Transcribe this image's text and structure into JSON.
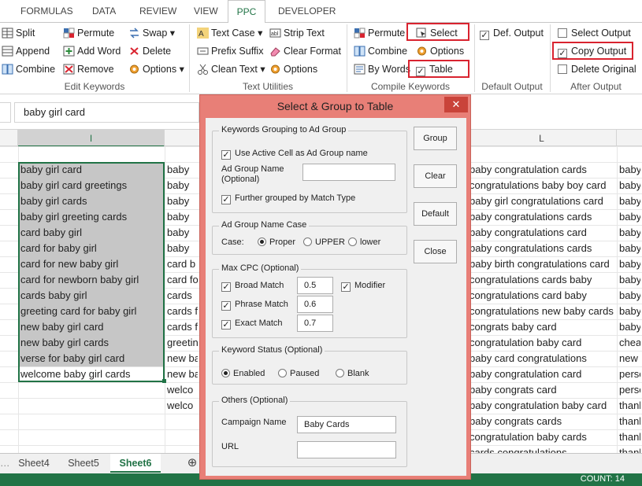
{
  "tabs": [
    "FORMULAS",
    "DATA",
    "REVIEW",
    "VIEW",
    "PPC",
    "DEVELOPER"
  ],
  "ribbon": {
    "edit_keywords": {
      "label": "Edit Keywords",
      "items": [
        "Split",
        "Append",
        "Combine",
        "Permute",
        "Add Word",
        "Remove",
        "Swap",
        "Delete",
        "Options"
      ]
    },
    "text_utilities": {
      "label": "Text Utilities",
      "items": [
        "Text Case",
        "Prefix Suffix",
        "Clean Text",
        "Strip Text",
        "Clear Format",
        "Options"
      ]
    },
    "compile_keywords": {
      "label": "Compile Keywords",
      "items": [
        "Permute",
        "Combine",
        "By Words",
        "Select",
        "Options",
        "Table"
      ]
    },
    "default_output": {
      "label": "Default Output",
      "item": "Def. Output"
    },
    "after_output": {
      "label": "After Output",
      "items": [
        "Select Output",
        "Copy Output",
        "Delete Original"
      ]
    }
  },
  "formula_bar": {
    "value": "baby girl card"
  },
  "columns": {
    "i": "I",
    "l": "L"
  },
  "col_i": [
    "baby girl card",
    "baby girl card greetings",
    "baby girl cards",
    "baby girl greeting cards",
    "card baby girl",
    "card for baby girl",
    "card for new baby girl",
    "card for newborn baby girl",
    "cards baby girl",
    "greeting card for baby girl",
    "new baby girl card",
    "new baby girl cards",
    "verse for baby girl card",
    "welcome baby girl cards"
  ],
  "col_j": [
    "baby",
    "baby",
    "baby",
    "baby",
    "baby",
    "baby",
    "card b",
    "card fo",
    "cards",
    "cards f",
    "cards f",
    "greetin",
    "new ba",
    "new ba",
    "welco",
    "welco"
  ],
  "col_l": [
    "baby congratulation cards",
    "congratulations baby boy card",
    "baby girl congratulations card",
    "baby congratulations cards",
    "baby congratulations card",
    "baby congratulations cards",
    "baby birth congratulations card",
    "congratulations cards baby",
    "congratulations card baby",
    "congratulations new baby cards",
    "congrats baby card",
    "congratulation baby card",
    "baby card congratulations",
    "baby congratulation card",
    "baby congrats card",
    "baby congratulation baby card",
    "baby congrats cards",
    "congratulation baby cards",
    "cards congratulations"
  ],
  "col_m": [
    "baby",
    "baby",
    "baby",
    "baby",
    "baby",
    "baby",
    "baby",
    "baby",
    "baby",
    "baby",
    "baby",
    "cheap",
    "new",
    "perso",
    "perso",
    "thank",
    "thank",
    "thank",
    "thank"
  ],
  "sheets": [
    "Sheet4",
    "Sheet5",
    "Sheet6"
  ],
  "status": {
    "count": "COUNT: 14"
  },
  "dialog": {
    "title": "Select & Group to Table",
    "close": "✕",
    "group1": {
      "legend": "Keywords Grouping to Ad Group",
      "use_active": "Use Active Cell as Ad Group name",
      "ad_group_name": "Ad Group Name",
      "optional": "(Optional)",
      "further": "Further grouped by Match Type",
      "ad_group_value": ""
    },
    "group2": {
      "legend": "Ad Group Name Case",
      "case": "Case:",
      "proper": "Proper",
      "upper": "UPPER",
      "lower": "lower"
    },
    "group3": {
      "legend": "Max CPC (Optional)",
      "broad": "Broad Match",
      "phrase": "Phrase Match",
      "exact": "Exact Match",
      "broad_val": "0.5",
      "phrase_val": "0.6",
      "exact_val": "0.7",
      "modifier": "Modifier"
    },
    "group4": {
      "legend": "Keyword Status (Optional)",
      "enabled": "Enabled",
      "paused": "Paused",
      "blank": "Blank"
    },
    "group5": {
      "legend": "Others (Optional)",
      "campaign": "Campaign Name",
      "campaign_val": "Baby Cards",
      "url": "URL",
      "url_val": ""
    },
    "buttons": {
      "group": "Group",
      "clear": "Clear",
      "default": "Default",
      "close": "Close"
    }
  },
  "colors": {
    "excel_green": "#217346",
    "dialog_border": "#e87f77",
    "highlight": "#d9232f",
    "selection": "#c6c6c6"
  }
}
